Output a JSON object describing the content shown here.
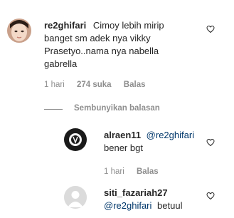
{
  "comment": {
    "username": "re2ghifari",
    "text_line1": "Cimoy lebih mirip",
    "text_line2": "banget sm adek nya vikky",
    "text_line3": "Prasetyo..nama nya nabella",
    "text_line4": "gabrella",
    "time": "1 hari",
    "likes": "274 suka",
    "reply_label": "Balas"
  },
  "hide_replies_label": "Sembunyikan balasan",
  "replies": [
    {
      "username": "alraen11",
      "mention": "@re2ghifari",
      "text": "bener bgt",
      "time": "1 hari",
      "reply_label": "Balas"
    },
    {
      "username": "siti_fazariah27",
      "mention": "@re2ghifari",
      "text": "betuul"
    }
  ],
  "icons": {
    "like": "heart-outline-icon"
  }
}
